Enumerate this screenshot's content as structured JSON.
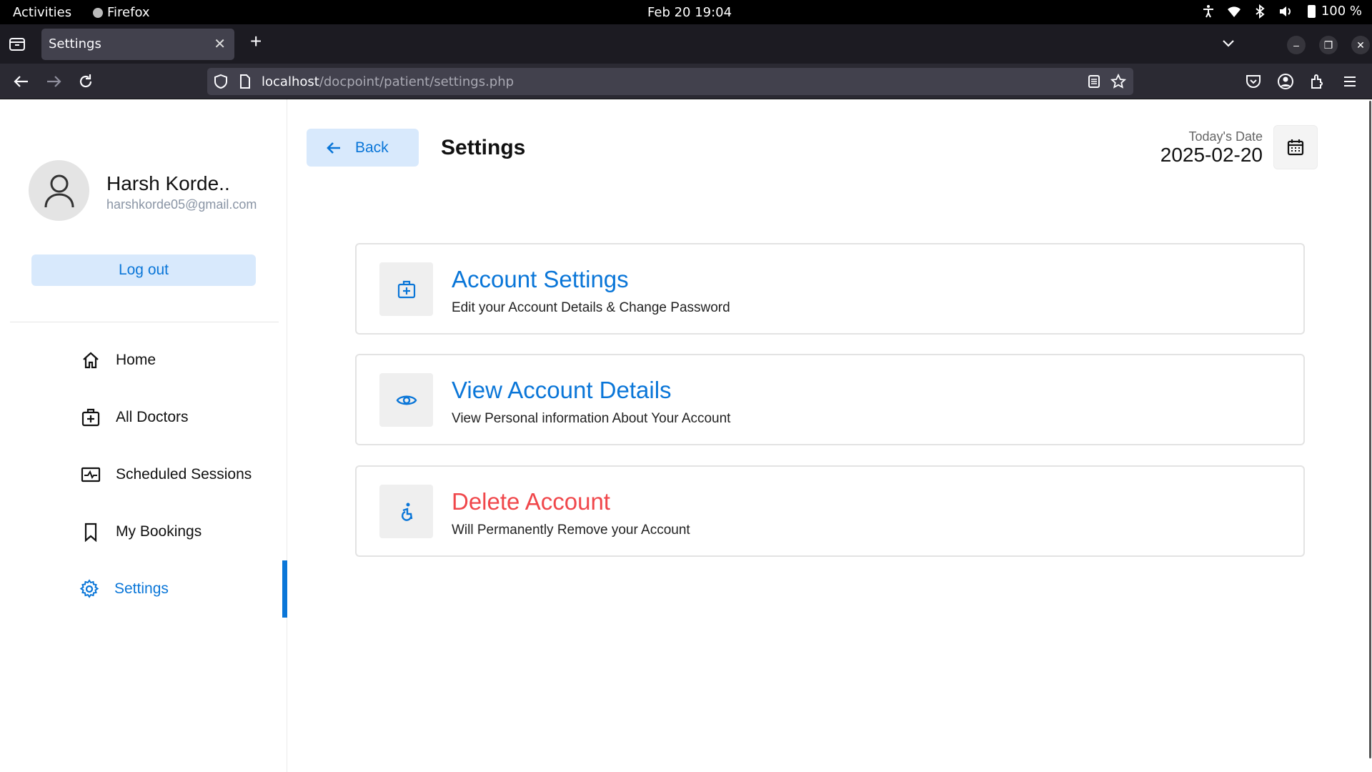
{
  "system_bar": {
    "activities": "Activities",
    "app_name": "Firefox",
    "clock": "Feb 20  19:04",
    "battery": "100 %"
  },
  "browser": {
    "tab_title": "Settings",
    "url_host": "localhost",
    "url_path": "/docpoint/patient/settings.php"
  },
  "sidebar": {
    "profile_name": "Harsh Korde..",
    "profile_email": "harshkorde05@gmail.com",
    "logout_label": "Log out",
    "items": [
      {
        "label": "Home",
        "icon": "home-icon"
      },
      {
        "label": "All Doctors",
        "icon": "medical-bag-icon"
      },
      {
        "label": "Scheduled Sessions",
        "icon": "schedule-icon"
      },
      {
        "label": "My Bookings",
        "icon": "bookmark-icon"
      },
      {
        "label": "Settings",
        "icon": "gear-icon"
      }
    ],
    "active_item": "Settings"
  },
  "header": {
    "back_label": "Back",
    "title": "Settings",
    "date_label": "Today's Date",
    "date_value": "2025-02-20"
  },
  "cards": [
    {
      "title": "Account Settings",
      "desc": "Edit your Account Details & Change Password",
      "icon": "medical-bag-icon"
    },
    {
      "title": "View Account Details",
      "desc": "View Personal information About Your Account",
      "icon": "eye-icon"
    },
    {
      "title": "Delete Account",
      "desc": "Will Permanently Remove your Account",
      "icon": "accessibility-icon"
    }
  ],
  "colors": {
    "accent": "#0a76d8",
    "accent_light": "#d8e9fc",
    "danger": "#f0474b"
  }
}
